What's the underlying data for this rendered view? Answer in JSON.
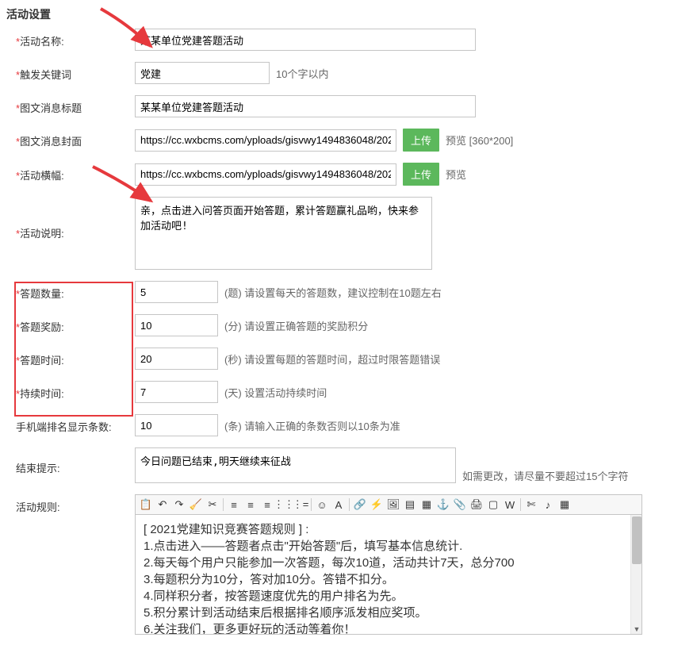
{
  "pageTitle": "活动设置",
  "fields": {
    "activityName": {
      "label": "活动名称:",
      "value": "某某单位党建答题活动"
    },
    "triggerKeyword": {
      "label": "触发关键词",
      "value": "党建",
      "hint": "10个字以内"
    },
    "articleTitle": {
      "label": "图文消息标题",
      "value": "某某单位党建答题活动"
    },
    "articleCover": {
      "label": "图文消息封面",
      "value": "https://cc.wxbcms.com/yploads/gisvwy1494836048/202",
      "btn": "上传",
      "hint": "预览 [360*200]"
    },
    "activityBanner": {
      "label": "活动横幅:",
      "value": "https://cc.wxbcms.com/yploads/gisvwy1494836048/202",
      "btn": "上传",
      "hint": "预览"
    },
    "activityDesc": {
      "label": "活动说明:",
      "value": "亲，点击进入问答页面开始答题，累计答题赢礼品哟，快来参加活动吧!"
    },
    "questionCount": {
      "label": "答题数量:",
      "value": "5",
      "hint": "(题) 请设置每天的答题数，建议控制在10题左右"
    },
    "questionReward": {
      "label": "答题奖励:",
      "value": "10",
      "hint": "(分) 请设置正确答题的奖励积分"
    },
    "questionTime": {
      "label": "答题时间:",
      "value": "20",
      "hint": "(秒) 请设置每题的答题时间，超过时限答题错误"
    },
    "duration": {
      "label": "持续时间:",
      "value": "7",
      "hint": "(天) 设置活动持续时间"
    },
    "rankCount": {
      "label": "手机端排名显示条数:",
      "value": "10",
      "hint": "(条) 请输入正确的条数否则以10条为准"
    },
    "endHint": {
      "label": "结束提示:",
      "value": "今日问题已结束,明天继续来征战",
      "sideHint": "如需更改，请尽量不要超过15个字符"
    },
    "activityRules": {
      "label": "活动规则:"
    }
  },
  "rulesBody": [
    "[ 2021党建知识竞赛答题规则 ] :",
    "1.点击进入——答题者点击\"开始答题\"后，填写基本信息统计.",
    "2.每天每个用户只能参加一次答题，每次10道，活动共计7天，总分700",
    "3.每题积分为10分，答对加10分。答错不扣分。",
    "4.同样积分者，按答题速度优先的用户排名为先。",
    "5.积分累计到活动结束后根据排名顺序派发相应奖项。",
    "6.关注我们，更多更好玩的活动等着你！"
  ],
  "toolbarIcons": [
    {
      "name": "source-icon",
      "g": "📋"
    },
    {
      "name": "undo-icon",
      "g": "↶"
    },
    {
      "name": "redo-icon",
      "g": "↷"
    },
    {
      "name": "cleardoc-icon",
      "g": "🧹"
    },
    {
      "name": "removeformat-icon",
      "g": "✂"
    },
    {
      "name": "sep"
    },
    {
      "name": "align-left-icon",
      "g": "≡"
    },
    {
      "name": "align-center-icon",
      "g": "≡"
    },
    {
      "name": "align-right-icon",
      "g": "≡"
    },
    {
      "name": "list-ol-icon",
      "g": "⋮⋮"
    },
    {
      "name": "list-ul-icon",
      "g": "⋮="
    },
    {
      "name": "sep"
    },
    {
      "name": "emoticon-icon",
      "g": "☺"
    },
    {
      "name": "forecolor-icon",
      "g": "A"
    },
    {
      "name": "sep"
    },
    {
      "name": "link-icon",
      "g": "🔗"
    },
    {
      "name": "unlink-icon",
      "g": "⚡"
    },
    {
      "name": "image-icon",
      "g": "🖼"
    },
    {
      "name": "video-icon",
      "g": "▤"
    },
    {
      "name": "table-icon",
      "g": "▦"
    },
    {
      "name": "anchor-icon",
      "g": "⚓"
    },
    {
      "name": "attachment-icon",
      "g": "📎"
    },
    {
      "name": "print-icon",
      "g": "🖨"
    },
    {
      "name": "template-icon",
      "g": "▢"
    },
    {
      "name": "pasteword-icon",
      "g": "W"
    },
    {
      "name": "sep"
    },
    {
      "name": "cut-icon",
      "g": "✄"
    },
    {
      "name": "music-icon",
      "g": "♪"
    },
    {
      "name": "code-icon",
      "g": "▦"
    }
  ]
}
